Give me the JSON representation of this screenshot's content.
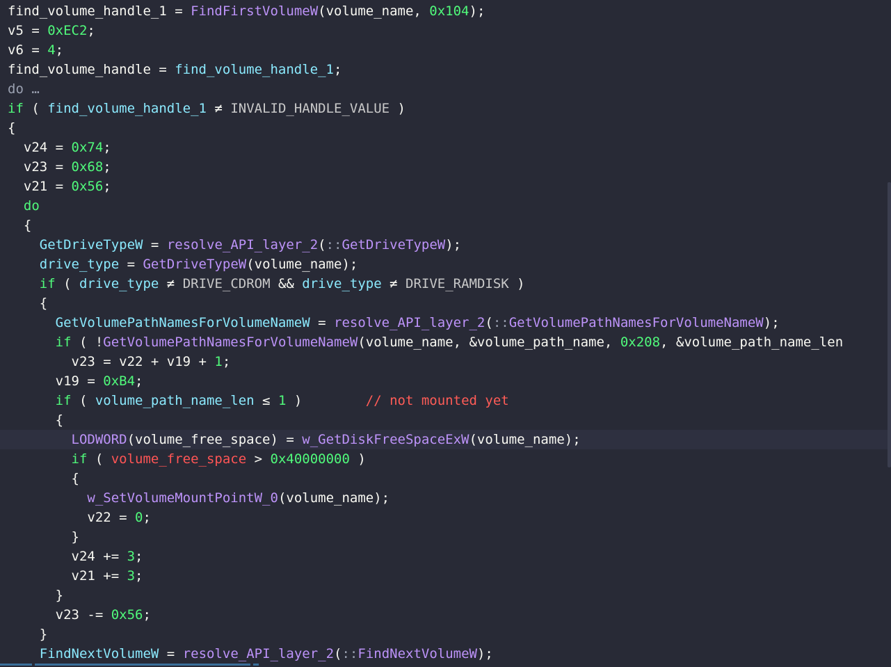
{
  "colors": {
    "background": "#282a36",
    "current_line": "#2e3040",
    "plain": "#f8f8f2",
    "variable": "#8be9fd",
    "function": "#bd93f9",
    "keyword": "#50fa7b",
    "number": "#50fa7b",
    "constant": "#c9c9c9",
    "highlight_var": "#ff5555",
    "comment": "#ff5c57",
    "dim": "#9aa0b0"
  },
  "current_line_index": 22,
  "lines": [
    [
      [
        "plain",
        "find_volume_handle_1 = "
      ],
      [
        "function",
        "FindFirstVolumeW"
      ],
      [
        "plain",
        "(volume_name, "
      ],
      [
        "number",
        "0x104"
      ],
      [
        "plain",
        ");"
      ]
    ],
    [
      [
        "plain",
        "v5 = "
      ],
      [
        "number",
        "0xEC2"
      ],
      [
        "plain",
        ";"
      ]
    ],
    [
      [
        "plain",
        "v6 = "
      ],
      [
        "number",
        "4"
      ],
      [
        "plain",
        ";"
      ]
    ],
    [
      [
        "plain",
        "find_volume_handle = "
      ],
      [
        "variable",
        "find_volume_handle_1"
      ],
      [
        "plain",
        ";"
      ]
    ],
    [
      [
        "dim",
        "do …"
      ]
    ],
    [
      [
        "keyword",
        "if"
      ],
      [
        "plain",
        " ( "
      ],
      [
        "variable",
        "find_volume_handle_1"
      ],
      [
        "plain",
        " ≠ "
      ],
      [
        "constant",
        "INVALID_HANDLE_VALUE"
      ],
      [
        "plain",
        " )"
      ]
    ],
    [
      [
        "plain",
        "{"
      ]
    ],
    [
      [
        "plain",
        "  v24 = "
      ],
      [
        "number",
        "0x74"
      ],
      [
        "plain",
        ";"
      ]
    ],
    [
      [
        "plain",
        "  v23 = "
      ],
      [
        "number",
        "0x68"
      ],
      [
        "plain",
        ";"
      ]
    ],
    [
      [
        "plain",
        "  v21 = "
      ],
      [
        "number",
        "0x56"
      ],
      [
        "plain",
        ";"
      ]
    ],
    [
      [
        "keyword",
        "  do"
      ]
    ],
    [
      [
        "plain",
        "  {"
      ]
    ],
    [
      [
        "plain",
        "    "
      ],
      [
        "variable",
        "GetDriveTypeW"
      ],
      [
        "plain",
        " = "
      ],
      [
        "function",
        "resolve_API_layer_2"
      ],
      [
        "plain",
        "("
      ],
      [
        "dim",
        "::"
      ],
      [
        "function",
        "GetDriveTypeW"
      ],
      [
        "plain",
        ");"
      ]
    ],
    [
      [
        "plain",
        "    "
      ],
      [
        "variable",
        "drive_type"
      ],
      [
        "plain",
        " = "
      ],
      [
        "function",
        "GetDriveTypeW"
      ],
      [
        "plain",
        "(volume_name);"
      ]
    ],
    [
      [
        "keyword",
        "    if"
      ],
      [
        "plain",
        " ( "
      ],
      [
        "variable",
        "drive_type"
      ],
      [
        "plain",
        " ≠ "
      ],
      [
        "constant",
        "DRIVE_CDROM"
      ],
      [
        "plain",
        " && "
      ],
      [
        "variable",
        "drive_type"
      ],
      [
        "plain",
        " ≠ "
      ],
      [
        "constant",
        "DRIVE_RAMDISK"
      ],
      [
        "plain",
        " )"
      ]
    ],
    [
      [
        "plain",
        "    {"
      ]
    ],
    [
      [
        "plain",
        "      "
      ],
      [
        "variable",
        "GetVolumePathNamesForVolumeNameW"
      ],
      [
        "plain",
        " = "
      ],
      [
        "function",
        "resolve_API_layer_2"
      ],
      [
        "plain",
        "("
      ],
      [
        "dim",
        "::"
      ],
      [
        "function",
        "GetVolumePathNamesForVolumeNameW"
      ],
      [
        "plain",
        ");"
      ]
    ],
    [
      [
        "keyword",
        "      if"
      ],
      [
        "plain",
        " ( !"
      ],
      [
        "function",
        "GetVolumePathNamesForVolumeNameW"
      ],
      [
        "plain",
        "(volume_name, &volume_path_name, "
      ],
      [
        "number",
        "0x208"
      ],
      [
        "plain",
        ", &volume_path_name_len"
      ]
    ],
    [
      [
        "plain",
        "        v23 = v22 + v19 + "
      ],
      [
        "number",
        "1"
      ],
      [
        "plain",
        ";"
      ]
    ],
    [
      [
        "plain",
        "      v19 = "
      ],
      [
        "number",
        "0xB4"
      ],
      [
        "plain",
        ";"
      ]
    ],
    [
      [
        "keyword",
        "      if"
      ],
      [
        "plain",
        " ( "
      ],
      [
        "variable",
        "volume_path_name_len"
      ],
      [
        "plain",
        " ≤ "
      ],
      [
        "number",
        "1"
      ],
      [
        "plain",
        " )        "
      ],
      [
        "comment",
        "// not mounted yet"
      ]
    ],
    [
      [
        "plain",
        "      {"
      ]
    ],
    [
      [
        "plain",
        "        "
      ],
      [
        "function",
        "LODWORD"
      ],
      [
        "plain",
        "(volume_free_space) = "
      ],
      [
        "function",
        "w_GetDiskFreeSpaceExW"
      ],
      [
        "plain",
        "(volume_name);"
      ]
    ],
    [
      [
        "keyword",
        "        if"
      ],
      [
        "plain",
        " ( "
      ],
      [
        "highlight_var",
        "volume_free_space"
      ],
      [
        "plain",
        " > "
      ],
      [
        "number",
        "0x40000000"
      ],
      [
        "plain",
        " )"
      ]
    ],
    [
      [
        "plain",
        "        {"
      ]
    ],
    [
      [
        "plain",
        "          "
      ],
      [
        "function",
        "w_SetVolumeMountPointW_0"
      ],
      [
        "plain",
        "(volume_name);"
      ]
    ],
    [
      [
        "plain",
        "          v22 = "
      ],
      [
        "number",
        "0"
      ],
      [
        "plain",
        ";"
      ]
    ],
    [
      [
        "plain",
        "        }"
      ]
    ],
    [
      [
        "plain",
        "        v24 += "
      ],
      [
        "number",
        "3"
      ],
      [
        "plain",
        ";"
      ]
    ],
    [
      [
        "plain",
        "        v21 += "
      ],
      [
        "number",
        "3"
      ],
      [
        "plain",
        ";"
      ]
    ],
    [
      [
        "plain",
        "      }"
      ]
    ],
    [
      [
        "plain",
        "      v23 -= "
      ],
      [
        "number",
        "0x56"
      ],
      [
        "plain",
        ";"
      ]
    ],
    [
      [
        "plain",
        "    }"
      ]
    ],
    [
      [
        "plain",
        "    "
      ],
      [
        "variable",
        "FindNextVolumeW"
      ],
      [
        "plain",
        " = "
      ],
      [
        "function",
        "resolve_API_layer_2"
      ],
      [
        "plain",
        "("
      ],
      [
        "dim",
        "::"
      ],
      [
        "function",
        "FindNextVolumeW"
      ],
      [
        "plain",
        ");"
      ]
    ]
  ]
}
